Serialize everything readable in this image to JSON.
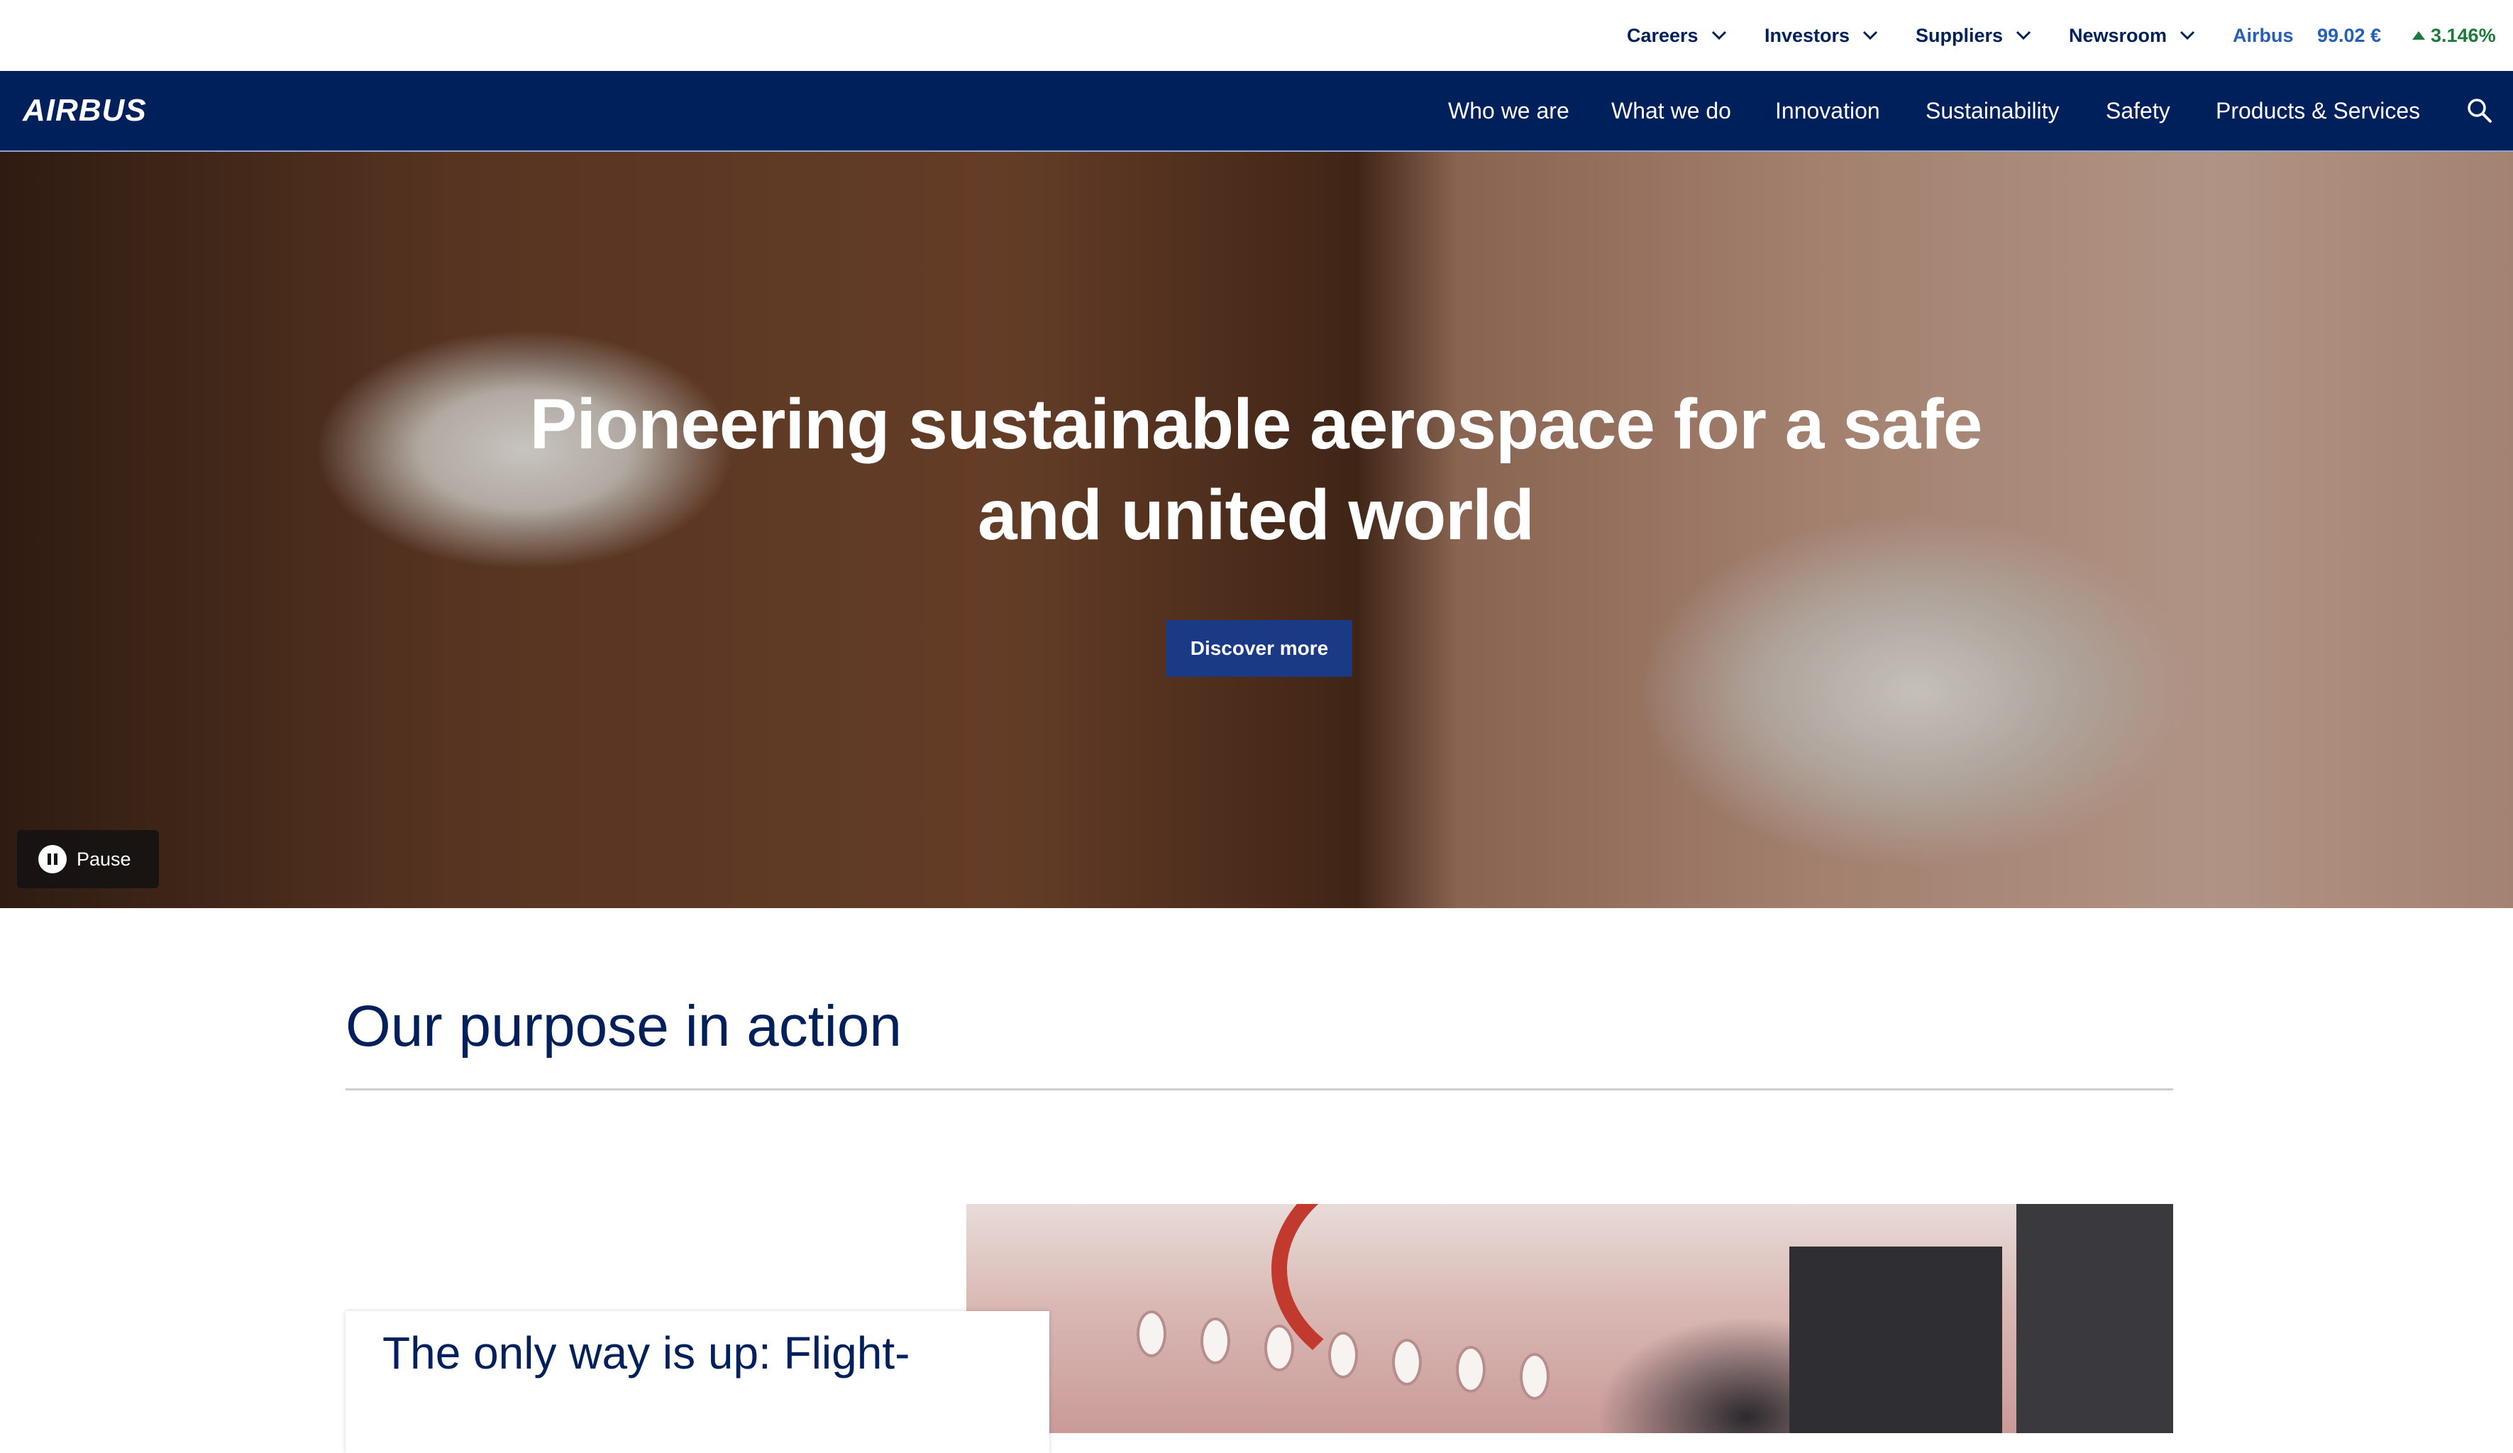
{
  "utility_nav": {
    "items": [
      {
        "label": "Careers"
      },
      {
        "label": "Investors"
      },
      {
        "label": "Suppliers"
      },
      {
        "label": "Newsroom"
      }
    ],
    "stock": {
      "name": "Airbus",
      "price": "99.02 €",
      "change": "3.146%",
      "trend": "up"
    }
  },
  "main_nav": {
    "logo": "AIRBUS",
    "items": [
      {
        "label": "Who we are"
      },
      {
        "label": "What we do"
      },
      {
        "label": "Innovation"
      },
      {
        "label": "Sustainability"
      },
      {
        "label": "Safety"
      },
      {
        "label": "Products & Services"
      }
    ],
    "search_icon": "search-icon"
  },
  "hero": {
    "title_line1": "Pioneering sustainable aerospace for a safe",
    "title_line2": "and united world",
    "cta": "Discover more",
    "pause_label": "Pause"
  },
  "purpose": {
    "title": "Our purpose in action",
    "feature_title": "The only way is up: Flight-"
  },
  "colors": {
    "brand_navy": "#00205b",
    "cta_blue": "#1b3a86",
    "stock_up": "#1e7a3c",
    "link_blue": "#255fb8"
  }
}
